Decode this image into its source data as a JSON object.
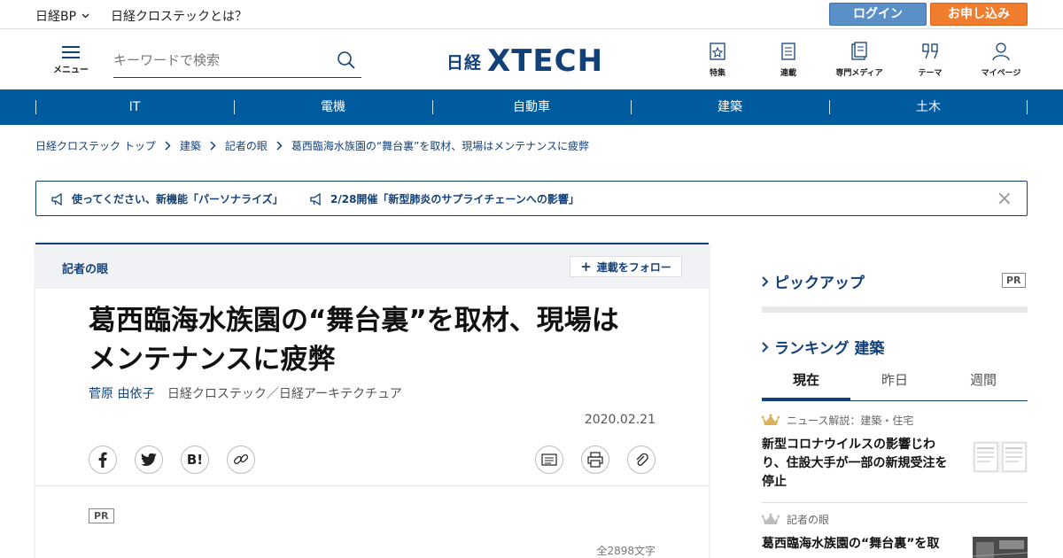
{
  "topbar": {
    "nikkei_bp": "日経BP",
    "about": "日経クロステックとは？",
    "login": "ログイン",
    "apply": "お申し込み"
  },
  "header": {
    "menu_label": "メニュー",
    "search_placeholder": "キーワードで検索",
    "logo_nikkei": "日経",
    "logo_xtech": "XTECH",
    "icons": [
      {
        "label": "特集",
        "icon": "feature-icon"
      },
      {
        "label": "連載",
        "icon": "series-icon"
      },
      {
        "label": "専門メディア",
        "icon": "media-icon"
      },
      {
        "label": "テーマ",
        "icon": "theme-icon"
      },
      {
        "label": "マイページ",
        "icon": "user-icon"
      }
    ]
  },
  "nav": {
    "items": [
      "IT",
      "電機",
      "自動車",
      "建築",
      "土木"
    ]
  },
  "breadcrumb": [
    "日経クロステック トップ",
    "建築",
    "記者の眼",
    "葛西臨海水族園の“舞台裏”を取材、現場はメンテナンスに疲弊"
  ],
  "notice": {
    "items": [
      "使ってください、新機能「パーソナライズ」",
      "2/28開催「新型肺炎のサプライチェーンへの影響」"
    ],
    "close": "×"
  },
  "article": {
    "series": "記者の眼",
    "follow": "連載をフォロー",
    "title_line1": "葛西臨海水族園の“舞台裏”を取材、現場は",
    "title_line2": "メンテナンスに疲弊",
    "author": "菅原 由依子",
    "publication": "日経クロステック／日経アーキテクチュア",
    "date": "2020.02.21",
    "pr": "PR",
    "char_count": "全2898文字",
    "share_icons": [
      "facebook-icon",
      "twitter-icon",
      "hatena-icon",
      "link-icon"
    ],
    "tool_icons": [
      "memo-icon",
      "print-icon",
      "clip-icon"
    ],
    "hatena_label": "B!"
  },
  "sidebar": {
    "pickup": "ピックアップ",
    "pr": "PR",
    "ranking": "ランキング 建築",
    "tabs": [
      "現在",
      "昨日",
      "週間"
    ],
    "ranks": [
      {
        "category": "ニュース解説：建築・住宅",
        "title": "新型コロナウイルスの影響じわり、住設大手が一部の新規受注を停止"
      },
      {
        "category": "記者の眼",
        "title": "葛西臨海水族園の“舞台裏”を取"
      }
    ]
  },
  "colors": {
    "brand": "#12417a",
    "nav_bg": "#005a9e",
    "login": "#5b8fc7",
    "apply": "#f07d2e"
  }
}
